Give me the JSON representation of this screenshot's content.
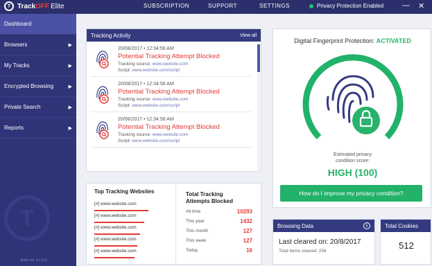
{
  "app": {
    "brand_a": "Track",
    "brand_b": "OFF",
    "edition": "Elite",
    "logo_letter": "T"
  },
  "topnav": {
    "subscription": "SUBSCRIPTION",
    "support": "SUPPORT",
    "settings": "SETTINGS",
    "privacy_status": "Privacy Protection Enabled"
  },
  "window": {
    "minimize": "—",
    "close": "✕"
  },
  "sidebar": {
    "items": [
      {
        "label": "Dashboard",
        "arrow": ""
      },
      {
        "label": "Browsers",
        "arrow": "▶"
      },
      {
        "label": "My Tracks",
        "arrow": "▶"
      },
      {
        "label": "Encrypted Browsing",
        "arrow": "▶"
      },
      {
        "label": "Private Search",
        "arrow": "▶"
      },
      {
        "label": "Reports",
        "arrow": "▶"
      }
    ],
    "watermark_letter": "T",
    "build": "Build ver. 4.1.0.0"
  },
  "activity": {
    "title": "Tracking Activity",
    "view_all": "View all",
    "entries": [
      {
        "time": "20/08/2017 • 12:34:56 AM",
        "title": "Potential Tracking Attempt Blocked",
        "src_label": "Tracking source:",
        "src": "www.website.com",
        "script_label": "Script:",
        "script": "www.website.com/script"
      },
      {
        "time": "20/08/2017 • 12:34:56 AM",
        "title": "Potential Tracking Attempt Blocked",
        "src_label": "Tracking source:",
        "src": "www.website.com",
        "script_label": "Script:",
        "script": "www.website.com/script"
      },
      {
        "time": "20/08/2017 • 12:34:56 AM",
        "title": "Potential Tracking Attempt Blocked",
        "src_label": "Tracking source:",
        "src": "www.website.com",
        "script_label": "Script:",
        "script": "www.website.com/script"
      }
    ]
  },
  "fingerprint": {
    "title_prefix": "Digital Fingerprint Protection:",
    "title_status": "ACTIVATED",
    "est_line1": "Estimated privacy",
    "est_line2": "condition score:",
    "score": "HIGH (100)",
    "button": "How do I improve my privacy condition?"
  },
  "top_sites": {
    "title": "Top Tracking Websites",
    "rows": [
      {
        "label": "[#] www.website.com",
        "share": 0.78
      },
      {
        "label": "[#] www.website.com",
        "share": 0.72
      },
      {
        "label": "[#] www.website.com",
        "share": 0.66
      },
      {
        "label": "[#] www.website.com",
        "share": 0.62
      },
      {
        "label": "[#] www.website.com",
        "share": 0.58
      }
    ]
  },
  "tracking_counts": {
    "title_line1": "Total Tracking",
    "title_line2": "Attempts Blocked",
    "rows": [
      {
        "label": "All time",
        "value": "10293"
      },
      {
        "label": "This year",
        "value": "1432"
      },
      {
        "label": "This month",
        "value": "127"
      },
      {
        "label": "This week",
        "value": "127"
      },
      {
        "label": "Today",
        "value": "16"
      }
    ]
  },
  "browsing": {
    "title": "Browsing Data",
    "info": "i",
    "last_cleared": "Last cleared on: 20/8/2017",
    "items_cleared": "Total items cleared: 256"
  },
  "cookies": {
    "title": "Total Cookies",
    "value": "512"
  },
  "colors": {
    "accent": "#343a80",
    "sidebar": "#2f3478",
    "green": "#27b36b",
    "red": "#e53935"
  }
}
